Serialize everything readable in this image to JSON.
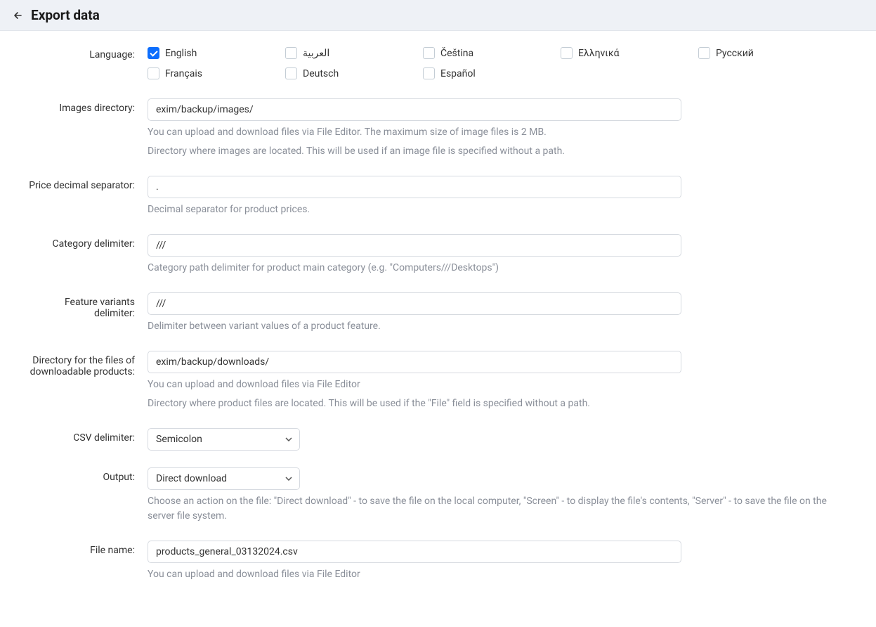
{
  "header": {
    "title": "Export data"
  },
  "labels": {
    "language": "Language:",
    "images_dir": "Images directory:",
    "price_sep": "Price decimal separator:",
    "cat_delim": "Category delimiter:",
    "feat_delim": "Feature variants delimiter:",
    "download_dir": "Directory for the files of downloadable products:",
    "csv_delim": "CSV delimiter:",
    "output": "Output:",
    "filename": "File name:"
  },
  "languages": [
    {
      "label": "English",
      "checked": true
    },
    {
      "label": "العربية",
      "checked": false
    },
    {
      "label": "Čeština",
      "checked": false
    },
    {
      "label": "Ελληνικά",
      "checked": false
    },
    {
      "label": "Русский",
      "checked": false
    },
    {
      "label": "Français",
      "checked": false
    },
    {
      "label": "Deutsch",
      "checked": false
    },
    {
      "label": "Español",
      "checked": false
    }
  ],
  "fields": {
    "images_dir": {
      "value": "exim/backup/images/",
      "help1": "You can upload and download files via File Editor. The maximum size of image files is 2 MB.",
      "help2": "Directory where images are located. This will be used if an image file is specified without a path."
    },
    "price_sep": {
      "value": ".",
      "help": "Decimal separator for product prices."
    },
    "cat_delim": {
      "value": "///",
      "help": "Category path delimiter for product main category (e.g. \"Computers///Desktops\")"
    },
    "feat_delim": {
      "value": "///",
      "help": "Delimiter between variant values of a product feature."
    },
    "download_dir": {
      "value": "exim/backup/downloads/",
      "help1": "You can upload and download files via File Editor",
      "help2": "Directory where product files are located. This will be used if the \"File\" field is specified without a path."
    },
    "csv_delim": {
      "value": "Semicolon"
    },
    "output": {
      "value": "Direct download",
      "help": "Choose an action on the file: \"Direct download\" - to save the file on the local computer, \"Screen\" - to display the file's contents, \"Server\" - to save the file on the server file system."
    },
    "filename": {
      "value": "products_general_03132024.csv",
      "help": "You can upload and download files via File Editor"
    }
  }
}
